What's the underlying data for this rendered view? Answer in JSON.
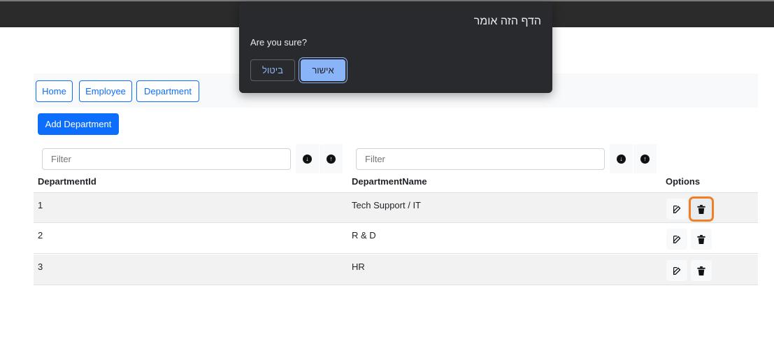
{
  "nav": {
    "home": "Home",
    "employee": "Employee",
    "department": "Department"
  },
  "toolbar": {
    "add_label": "Add Department"
  },
  "filters": {
    "id_placeholder": "Filter",
    "name_placeholder": "Filter"
  },
  "table": {
    "headers": {
      "id": "DepartmentId",
      "name": "DepartmentName",
      "options": "Options"
    },
    "rows": [
      {
        "id": "1",
        "name": "Tech Support / IT"
      },
      {
        "id": "2",
        "name": "R & D"
      },
      {
        "id": "3",
        "name": "HR"
      }
    ]
  },
  "dialog": {
    "title": "הדף הזה אומר",
    "message": "Are you sure?",
    "cancel_label": "ביטול",
    "ok_label": "אישור"
  },
  "icons": {
    "sort_desc": "arrow-down-circle-icon",
    "sort_asc": "arrow-up-circle-icon",
    "edit": "edit-icon",
    "delete": "trash-icon"
  },
  "colors": {
    "primary": "#0d6efd",
    "focus_ring": "#f07f2a",
    "dialog_bg": "#292a2d",
    "dialog_accent": "#8ab4f8"
  }
}
